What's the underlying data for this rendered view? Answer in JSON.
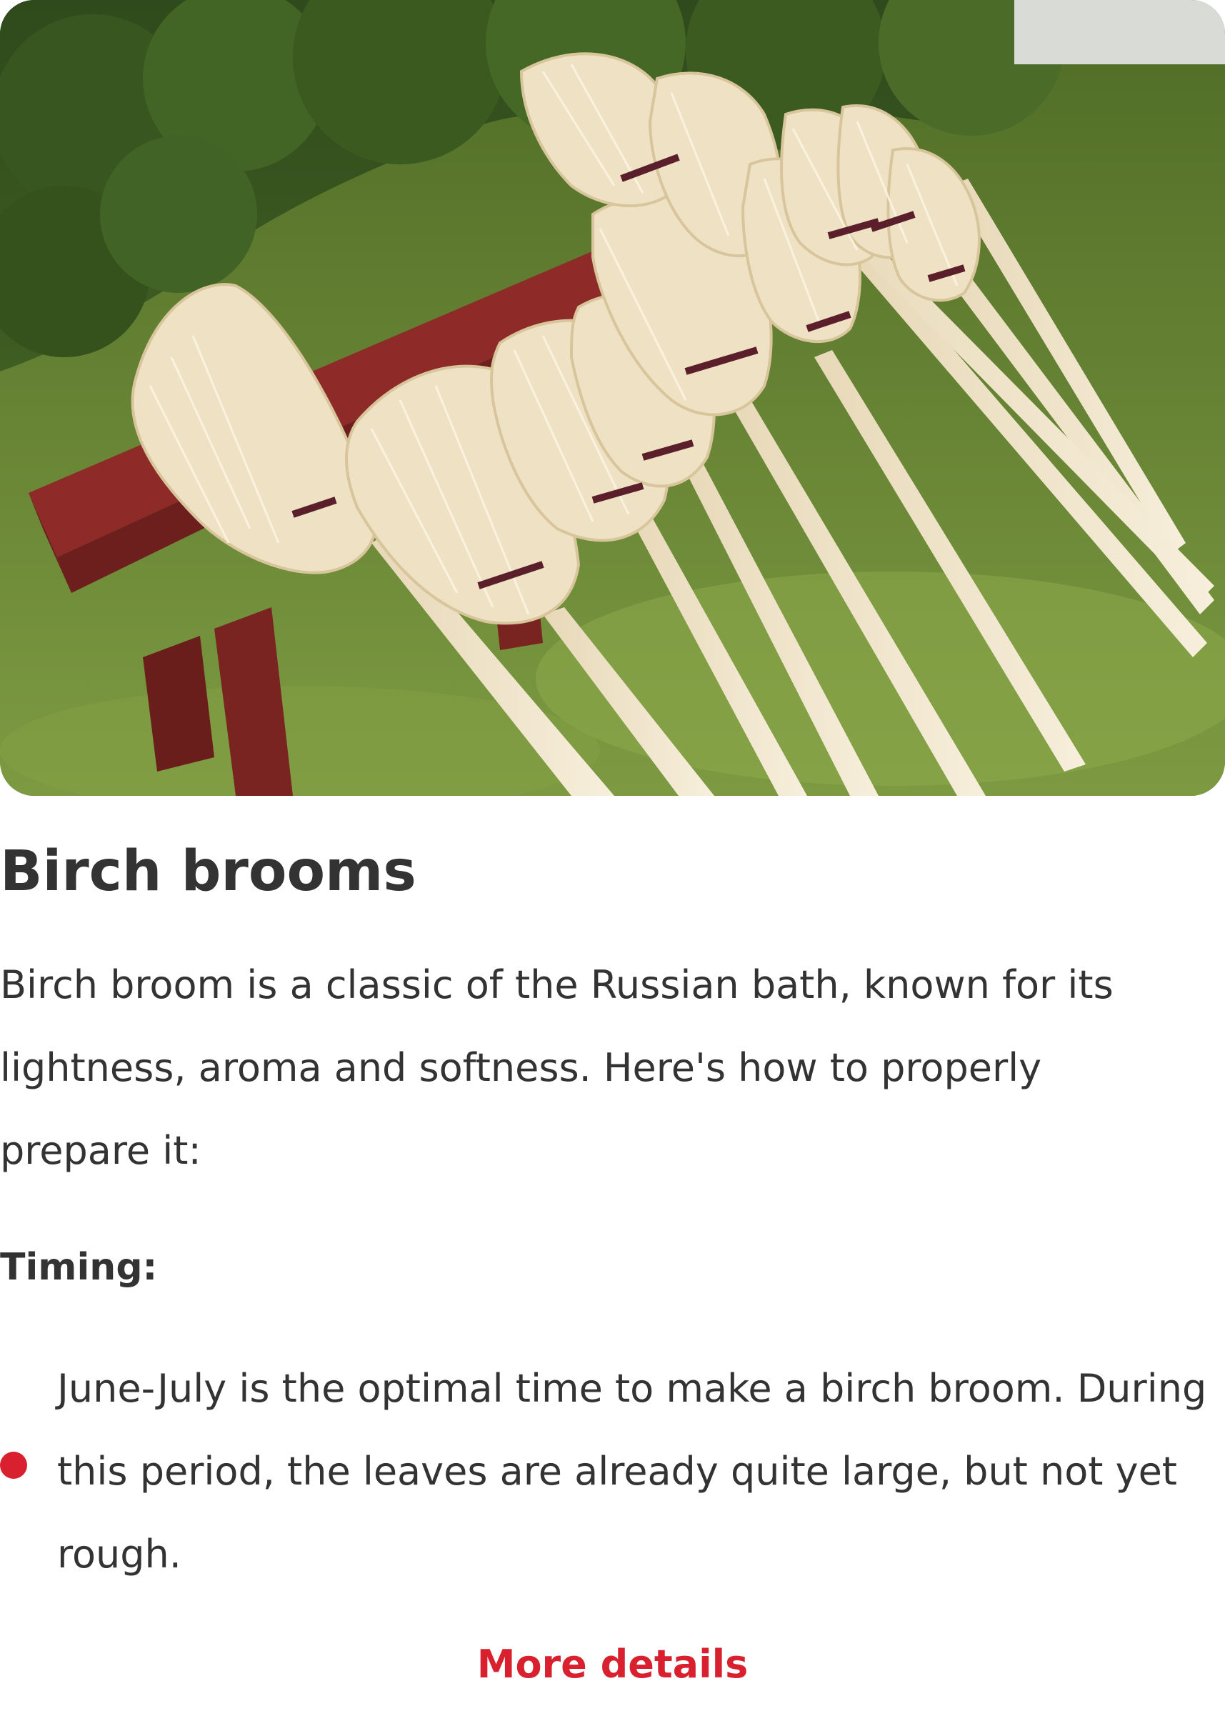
{
  "card": {
    "image": {
      "subject": "birch brooms leaning on red bench on grass"
    },
    "title": "Birch brooms",
    "intro": "Birch broom is a classic of the Russian bath, known for its lightness, aroma and softness. Here's how to properly prepare it:",
    "section_heading": "Timing:",
    "bullets": [
      "June-July is the optimal time to make a birch broom. During this period, the leaves are already quite large, but not yet rough."
    ],
    "more_link": "More details"
  },
  "colors": {
    "text": "#333333",
    "accent": "#d8202e",
    "bench": "#8e2a27",
    "grass": "#5e7f2e",
    "broom": "#efe2c4"
  }
}
